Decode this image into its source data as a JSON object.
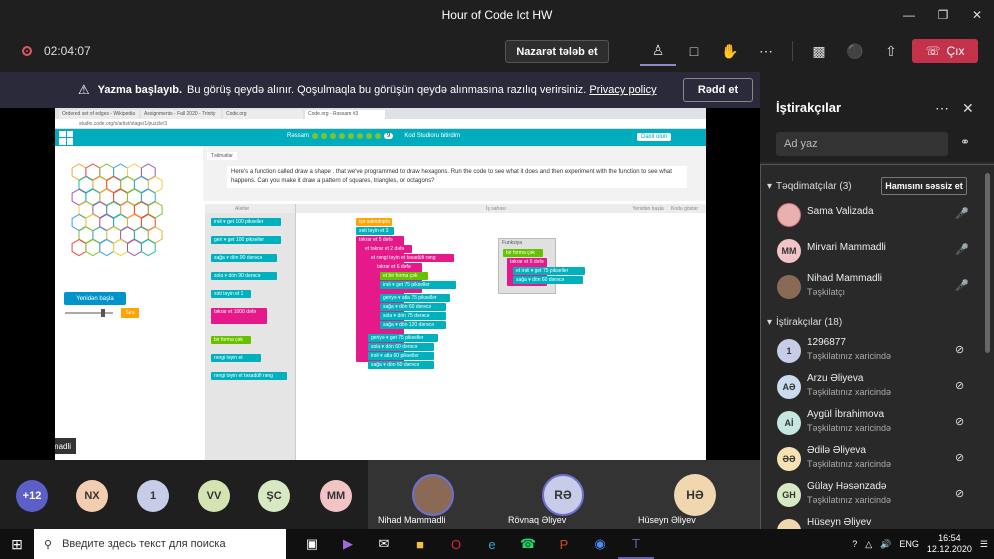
{
  "window": {
    "title": "Hour of Code Ict HW",
    "controls": [
      "—",
      "❐",
      "✕",
      "✕"
    ]
  },
  "meeting_toolbar": {
    "recording_time": "02:04:07",
    "take_control_label": "Nazarət tələb et",
    "icons": [
      "people-icon",
      "chat-icon",
      "raise-hand-icon",
      "more-icon",
      "camera-off-icon",
      "mic-icon",
      "share-icon"
    ],
    "leave_label": "Çıx"
  },
  "recording_banner": {
    "title": "Yazma başlayıb.",
    "text": "Bu görüş qeydə alınır. Qoşulmaqla bu görüşün qeydə alınmasına razılıq verirsiniz.",
    "link": "Privacy policy",
    "dismiss_label": "Rədd et"
  },
  "shared_screen": {
    "browser_tabs": [
      "Ordered set of edges - Wikipedia",
      "Assignments - Fall 2020 - Trinity",
      "Code.org",
      "Code.org - Rəssam #3"
    ],
    "url": "studio.code.org/s/artist/stage/1/puzzle/3",
    "level_label": "Rəssam",
    "level_number": "9",
    "signin_text": "Kod Studioru bitirdim",
    "mine_label": "Daxil olun",
    "instructions_tab": "Təlimatlar",
    "instructions": "Here's a function called  draw a shape . that we've programmed to draw hexagons. Run the code to see what it does and then experiment with the function to see what happens. Can you make it draw a pattern of squares, triangles, or octagons?",
    "toolbox_label": "Alətlər",
    "workspace_label": "İş sahəsi",
    "restart_label": "Yenidən başla",
    "show_code_label": "Kodu göstər",
    "reset_label": "Yenidən başla",
    "step_label": "Sıra",
    "presenter_name": "Nihad Mammadli",
    "toolbox_blocks": [
      "irəli ▾ get 100 pikseller",
      "geri ▾ get 100 pikseller",
      "sağa ▾ dön 90 dərəcə",
      "sola ▾ dön 90 dərəcə",
      "xəti təyin et 1",
      "təkrar et 1000 dəfə",
      "bir forma çək",
      "rəngi təyin et",
      "rəngi təyin et  təsadüfi rəng"
    ],
    "work_blocks": [
      "işə salındıqda",
      "xəti təyin et 3",
      "təkrar et 5 dəfə",
      "et  təkrar et 2 dəfə",
      "et  rəngi təyin et  təsadüfi rəng",
      "təkrar et 6 dəfə",
      "et  bir forma çək",
      "irəli ▾ get 75 pikseller",
      "geriyə ▾ atla 75 pikseller",
      "sağa ▾ dön 60 dərəcə",
      "sola ▾ dön 75 dərəcə",
      "sağa ▾ dön 120 dərəcə",
      "geriyə ▾ get 75 pikseller",
      "sola ▾ dön 60 dərəcə",
      "irəli ▾ atla 60 pikseller",
      "sağa ▾ dön 60 dərəcə"
    ],
    "function_title": "Funksiya",
    "function_blocks": [
      "bir forma çək",
      "təkrar et 6 dəfə",
      "et  irəli ▾ get 75 pikseller",
      "sağa ▾ dön 60 dərəcə"
    ]
  },
  "participants_panel": {
    "title": "İştirakçılar",
    "search_placeholder": "Ad yaz",
    "presenters_section": "Təqdimatçılar (3)",
    "mute_all_label": "Hamısını səssiz et",
    "presenters": [
      {
        "name": "Sama Valizada",
        "initials": "",
        "color": "#e9b0b0",
        "sub": ""
      },
      {
        "name": "Mirvari Mammadli",
        "initials": "MM",
        "color": "#f2c4c8",
        "sub": ""
      },
      {
        "name": "Nihad Mammadli",
        "initials": "",
        "color": "#8a6a55",
        "sub": "Təşkilatçı"
      }
    ],
    "attendees_section": "İştirakçılar (18)",
    "attendees": [
      {
        "name": "1296877",
        "initials": "1",
        "color": "#c7cce8",
        "sub": "Təşkilatınız xaricində"
      },
      {
        "name": "Arzu Əliyeva",
        "initials": "AƏ",
        "color": "#c9dbee",
        "sub": "Təşkilatınız xaricində"
      },
      {
        "name": "Aygül İbrahimova",
        "initials": "Aİ",
        "color": "#c8e6e0",
        "sub": "Təşkilatınız xaricində"
      },
      {
        "name": "Ədilə Əliyeva",
        "initials": "ƏƏ",
        "color": "#f6e2b2",
        "sub": "Təşkilatınız xaricində"
      },
      {
        "name": "Gülay Həsənzadə",
        "initials": "GH",
        "color": "#d6e9c3",
        "sub": "Təşkilatınız xaricində"
      },
      {
        "name": "Hüseyn Əliyev",
        "initials": "",
        "color": "#f0d7b0",
        "sub": ""
      }
    ]
  },
  "video_strip": {
    "overflow": "+12",
    "bubbles": [
      {
        "label": "NX",
        "color": "#f3cdb0"
      },
      {
        "label": "1",
        "color": "#c7cce8"
      },
      {
        "label": "VV",
        "color": "#d4e3b2"
      },
      {
        "label": "ŞC",
        "color": "#d6e9c3"
      },
      {
        "label": "MM",
        "color": "#f2c4c8"
      }
    ],
    "tiles": [
      {
        "name": "Nihad Mammadli",
        "initials": ""
      },
      {
        "name": "Rövnaq Əliyev",
        "initials": "RƏ"
      },
      {
        "name": "Hüseyn Əliyev",
        "initials": "HƏ"
      }
    ]
  },
  "taskbar": {
    "search_placeholder": "Введите здесь текст для поиска",
    "apps": [
      "task-view-icon",
      "visual-studio-icon",
      "mail-icon",
      "file-explorer-icon",
      "opera-icon",
      "edge-icon",
      "whatsapp-icon",
      "powerpoint-icon",
      "chrome-icon",
      "teams-icon"
    ],
    "language": "ENG",
    "time": "16:54",
    "date": "12.12.2020"
  }
}
